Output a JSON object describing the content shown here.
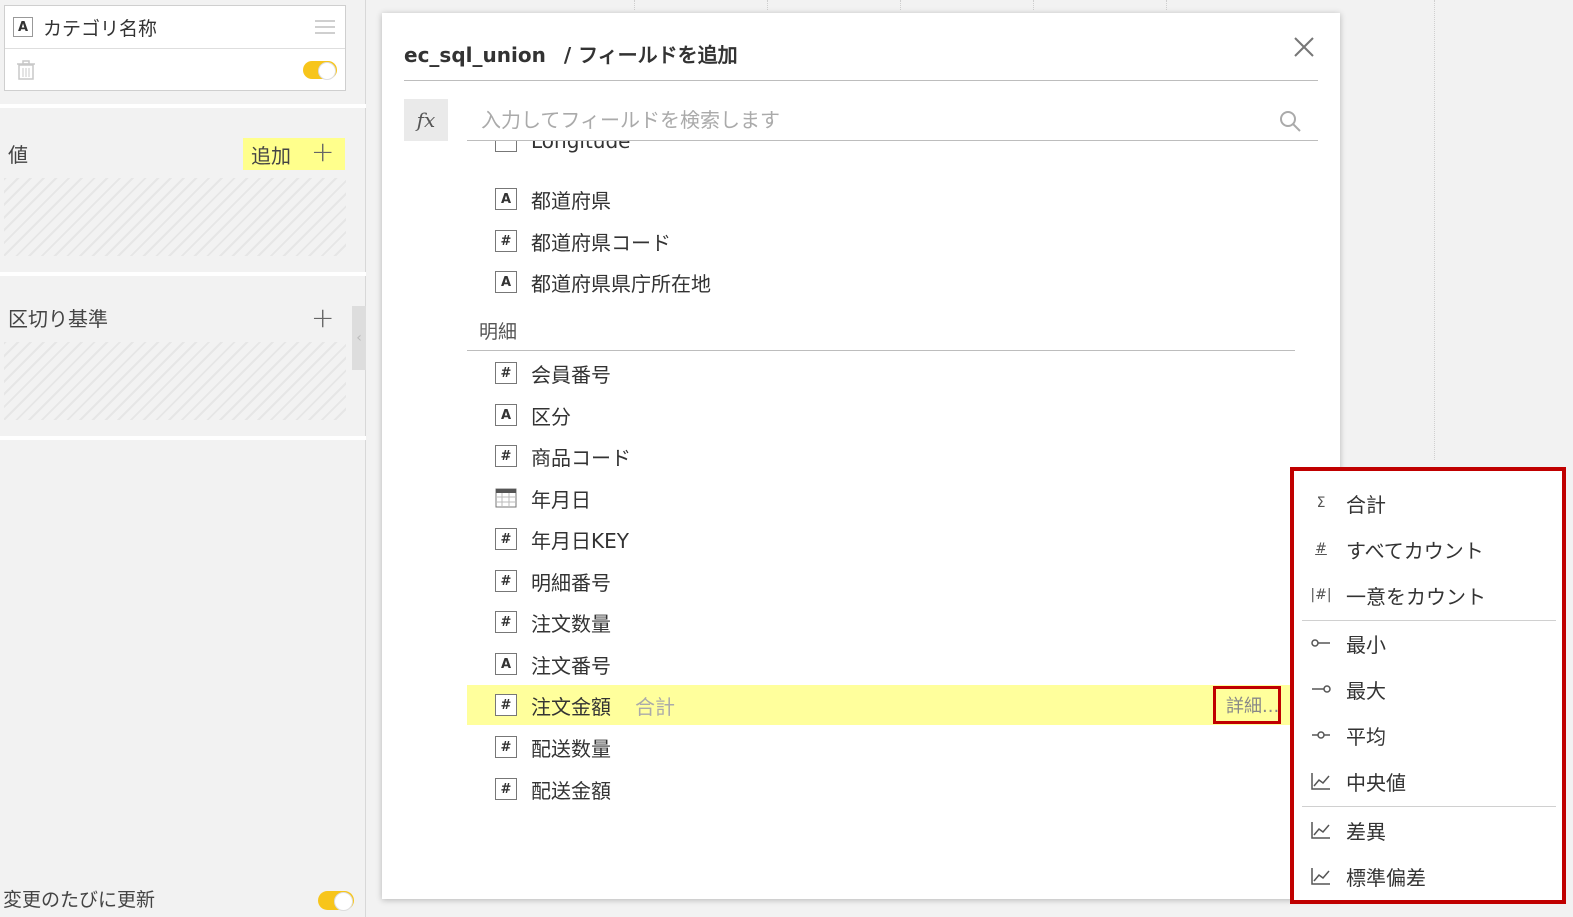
{
  "left_panel": {
    "category_field": {
      "type_icon": "A",
      "label": "カテゴリ名称"
    },
    "values_section": {
      "title": "値",
      "add_label": "追加",
      "plus": "+"
    },
    "breakdown_section": {
      "title": "区切り基準",
      "plus": "+"
    },
    "update_label": "変更のたびに更新",
    "collapse_glyph": "‹"
  },
  "dialog": {
    "datasource": "ec_sql_union",
    "title": "/ フィールドを追加",
    "fx_label": "fx",
    "search_placeholder": "入力してフィールドを検索します",
    "partial_item": "Longitude",
    "fields_top": [
      {
        "type": "A",
        "label": "都道府県"
      },
      {
        "type": "#",
        "label": "都道府県コード"
      },
      {
        "type": "A",
        "label": "都道府県県庁所在地"
      }
    ],
    "group_title": "明細",
    "fields_detail": [
      {
        "type": "#",
        "label": "会員番号"
      },
      {
        "type": "A",
        "label": "区分"
      },
      {
        "type": "#",
        "label": "商品コード"
      },
      {
        "type": "calendar",
        "label": "年月日"
      },
      {
        "type": "#",
        "label": "年月日KEY"
      },
      {
        "type": "#",
        "label": "明細番号"
      },
      {
        "type": "#",
        "label": "注文数量"
      },
      {
        "type": "A",
        "label": "注文番号"
      },
      {
        "type": "#",
        "label": "注文金額",
        "aggregation": "合計",
        "detail": "詳細...",
        "highlighted": true
      },
      {
        "type": "#",
        "label": "配送数量"
      },
      {
        "type": "#",
        "label": "配送金額"
      }
    ]
  },
  "aggregation_menu": {
    "items": [
      {
        "icon": "Σ",
        "label": "合計"
      },
      {
        "icon": "#",
        "label": "すべてカウント"
      },
      {
        "icon": "|#|",
        "label": "一意をカウント"
      },
      {
        "icon": "min-icon",
        "label": "最小"
      },
      {
        "icon": "max-icon",
        "label": "最大"
      },
      {
        "icon": "avg-icon",
        "label": "平均"
      },
      {
        "icon": "trend-icon",
        "label": "中央値"
      },
      {
        "icon": "trend-icon",
        "label": "差異"
      },
      {
        "icon": "trend-icon",
        "label": "標準偏差"
      }
    ]
  },
  "colors": {
    "highlight": "#ffff9c",
    "toggle": "#f7c51b",
    "callout": "#c00000"
  }
}
